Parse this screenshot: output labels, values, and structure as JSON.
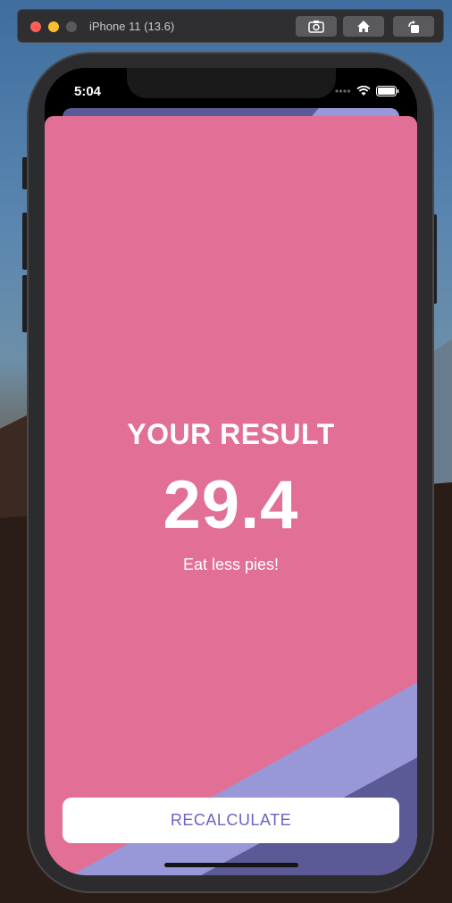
{
  "simulator": {
    "title": "iPhone 11 (13.6)",
    "icons": [
      "screenshot-icon",
      "home-icon",
      "rotate-icon"
    ]
  },
  "status_bar": {
    "time": "5:04",
    "icons": [
      "signal-icon",
      "wifi-icon",
      "battery-icon"
    ]
  },
  "result": {
    "title": "YOUR RESULT",
    "value": "29.4",
    "message": "Eat less pies!"
  },
  "actions": {
    "recalculate_label": "RECALCULATE"
  },
  "colors": {
    "sheet_background": "#e26f96",
    "accent_light": "#9898d8",
    "accent_dark": "#5b5a96",
    "button_text": "#6a64c4"
  }
}
